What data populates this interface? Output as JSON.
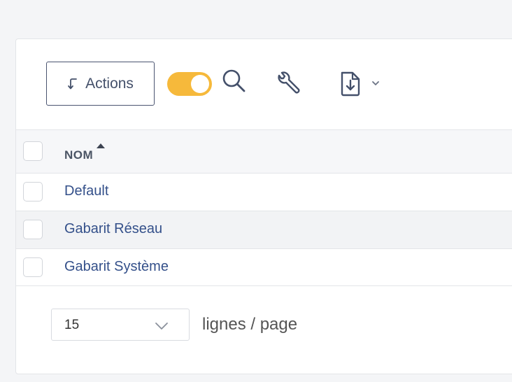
{
  "toolbar": {
    "actions_label": "Actions",
    "toggle_state": "on",
    "icons": [
      "return-arrow-icon",
      "search-icon",
      "wrench-icon",
      "file-export-icon",
      "chevron-down-icon"
    ]
  },
  "table": {
    "columns": [
      {
        "label": "NOM",
        "sort": "ascending"
      }
    ],
    "rows": [
      {
        "name": "Default"
      },
      {
        "name": "Gabarit Réseau"
      },
      {
        "name": "Gabarit Système"
      }
    ]
  },
  "pagination": {
    "per_page_value": "15",
    "per_page_label": "lignes / page"
  },
  "colors": {
    "toggle": "#f6b93b",
    "link": "#34508a",
    "border": "#4a5470"
  }
}
